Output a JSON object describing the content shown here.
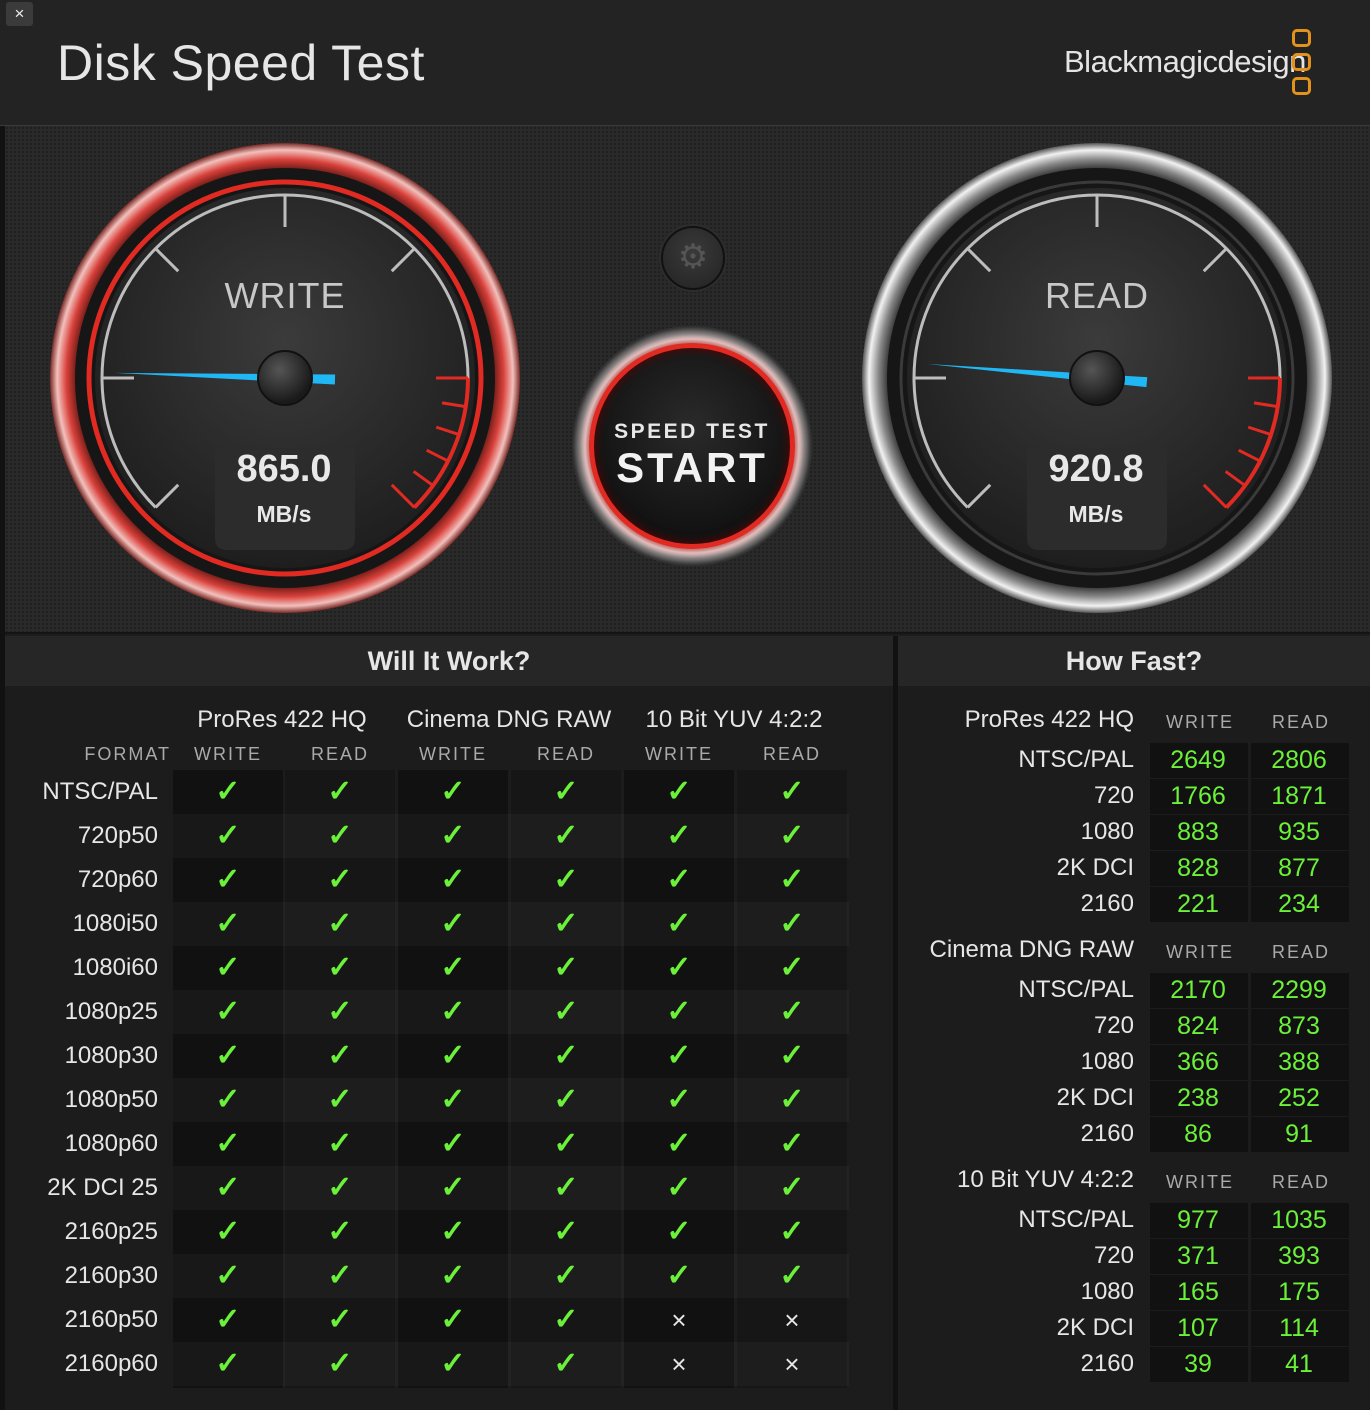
{
  "window": {
    "close_icon": "close-icon",
    "close_label": "×",
    "title": "Disk Speed Test",
    "brand": "Blackmagicdesign"
  },
  "gauges": {
    "write": {
      "label": "WRITE",
      "value": "865.0",
      "unit": "MB/s"
    },
    "read": {
      "label": "READ",
      "value": "920.8",
      "unit": "MB/s"
    }
  },
  "controls": {
    "settings_icon": "gear-icon",
    "start_small": "SPEED TEST",
    "start_big": "START"
  },
  "colors": {
    "accent_red": "#e02a22",
    "needle_blue": "#1fb8f5",
    "check_green": "#6cf13a",
    "brand_orange": "#e3931c"
  },
  "will_it_work": {
    "title": "Will It Work?",
    "format_header": "FORMAT",
    "codecs": [
      "ProRes 422 HQ",
      "Cinema DNG RAW",
      "10 Bit YUV 4:2:2"
    ],
    "col_write": "WRITE",
    "col_read": "READ",
    "rows": [
      {
        "format": "NTSC/PAL",
        "results": [
          true,
          true,
          true,
          true,
          true,
          true
        ]
      },
      {
        "format": "720p50",
        "results": [
          true,
          true,
          true,
          true,
          true,
          true
        ]
      },
      {
        "format": "720p60",
        "results": [
          true,
          true,
          true,
          true,
          true,
          true
        ]
      },
      {
        "format": "1080i50",
        "results": [
          true,
          true,
          true,
          true,
          true,
          true
        ]
      },
      {
        "format": "1080i60",
        "results": [
          true,
          true,
          true,
          true,
          true,
          true
        ]
      },
      {
        "format": "1080p25",
        "results": [
          true,
          true,
          true,
          true,
          true,
          true
        ]
      },
      {
        "format": "1080p30",
        "results": [
          true,
          true,
          true,
          true,
          true,
          true
        ]
      },
      {
        "format": "1080p50",
        "results": [
          true,
          true,
          true,
          true,
          true,
          true
        ]
      },
      {
        "format": "1080p60",
        "results": [
          true,
          true,
          true,
          true,
          true,
          true
        ]
      },
      {
        "format": "2K DCI 25",
        "results": [
          true,
          true,
          true,
          true,
          true,
          true
        ]
      },
      {
        "format": "2160p25",
        "results": [
          true,
          true,
          true,
          true,
          true,
          true
        ]
      },
      {
        "format": "2160p30",
        "results": [
          true,
          true,
          true,
          true,
          true,
          true
        ]
      },
      {
        "format": "2160p50",
        "results": [
          true,
          true,
          true,
          true,
          false,
          false
        ]
      },
      {
        "format": "2160p60",
        "results": [
          true,
          true,
          true,
          true,
          false,
          false
        ]
      }
    ],
    "check_glyph": "✓",
    "cross_glyph": "×"
  },
  "how_fast": {
    "title": "How Fast?",
    "col_write": "WRITE",
    "col_read": "READ",
    "groups": [
      {
        "codec": "ProRes 422 HQ",
        "rows": [
          {
            "label": "NTSC/PAL",
            "write": "2649",
            "read": "2806"
          },
          {
            "label": "720",
            "write": "1766",
            "read": "1871"
          },
          {
            "label": "1080",
            "write": "883",
            "read": "935"
          },
          {
            "label": "2K DCI",
            "write": "828",
            "read": "877"
          },
          {
            "label": "2160",
            "write": "221",
            "read": "234"
          }
        ]
      },
      {
        "codec": "Cinema DNG RAW",
        "rows": [
          {
            "label": "NTSC/PAL",
            "write": "2170",
            "read": "2299"
          },
          {
            "label": "720",
            "write": "824",
            "read": "873"
          },
          {
            "label": "1080",
            "write": "366",
            "read": "388"
          },
          {
            "label": "2K DCI",
            "write": "238",
            "read": "252"
          },
          {
            "label": "2160",
            "write": "86",
            "read": "91"
          }
        ]
      },
      {
        "codec": "10 Bit YUV 4:2:2",
        "rows": [
          {
            "label": "NTSC/PAL",
            "write": "977",
            "read": "1035"
          },
          {
            "label": "720",
            "write": "371",
            "read": "393"
          },
          {
            "label": "1080",
            "write": "165",
            "read": "175"
          },
          {
            "label": "2K DCI",
            "write": "107",
            "read": "114"
          },
          {
            "label": "2160",
            "write": "39",
            "read": "41"
          }
        ]
      }
    ]
  }
}
